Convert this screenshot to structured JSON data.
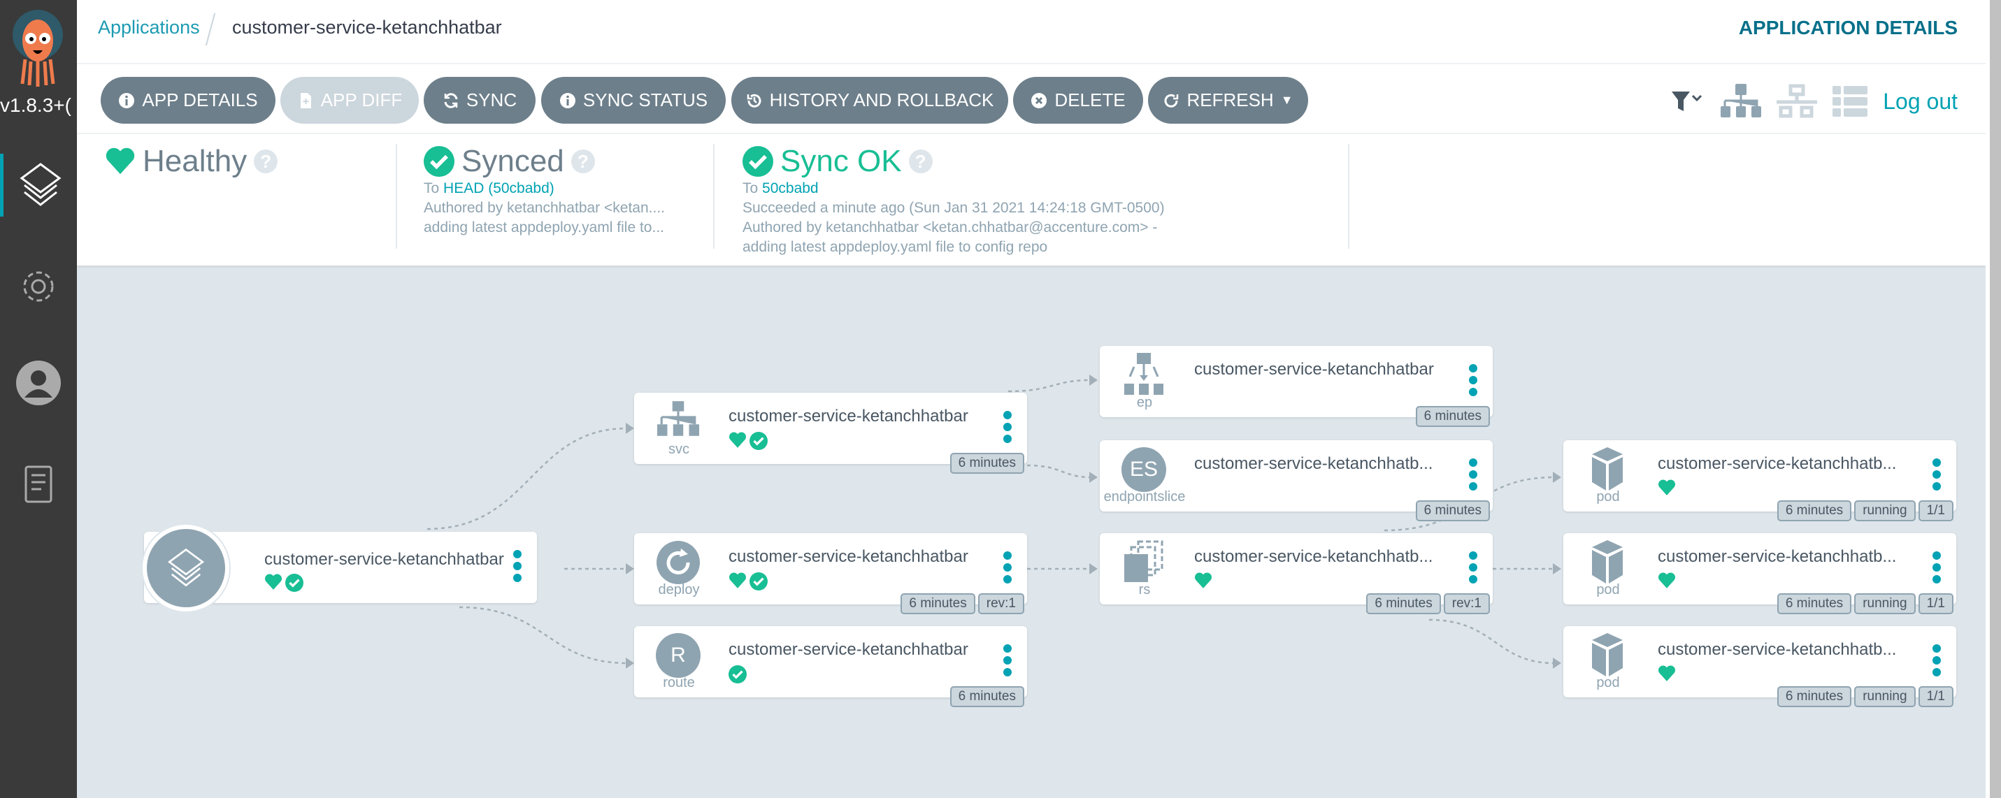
{
  "sidebar": {
    "version": "v1.8.3+(",
    "items": [
      {
        "name": "applications",
        "icon": "layers-icon",
        "active": true
      },
      {
        "name": "settings",
        "icon": "gear-icon",
        "active": false
      },
      {
        "name": "user-info",
        "icon": "user-icon",
        "active": false
      },
      {
        "name": "documentation",
        "icon": "docs-icon",
        "active": false
      }
    ]
  },
  "header": {
    "breadcrumb_root": "Applications",
    "breadcrumb_current": "customer-service-ketanchhatbar",
    "title": "APPLICATION DETAILS"
  },
  "toolbar": {
    "buttons": [
      {
        "label": "APP DETAILS",
        "icon": "info-icon",
        "disabled": false
      },
      {
        "label": "APP DIFF",
        "icon": "file-diff-icon",
        "disabled": true
      },
      {
        "label": "SYNC",
        "icon": "sync-icon",
        "disabled": false
      },
      {
        "label": "SYNC STATUS",
        "icon": "info-icon",
        "disabled": false
      },
      {
        "label": "HISTORY AND ROLLBACK",
        "icon": "history-icon",
        "disabled": false
      },
      {
        "label": "DELETE",
        "icon": "times-circle-icon",
        "disabled": false
      },
      {
        "label": "REFRESH",
        "icon": "redo-icon",
        "disabled": false
      }
    ],
    "logout": "Log out"
  },
  "status": {
    "health": {
      "label": "Healthy"
    },
    "sync": {
      "label": "Synced",
      "to_prefix": "To",
      "revision": "HEAD (50cbabd)",
      "author": "Authored by ketanchhatbar <ketan....",
      "message": "adding latest appdeploy.yaml file to..."
    },
    "operation": {
      "label": "Sync OK",
      "to_prefix": "To",
      "revision": "50cbabd",
      "time": "Succeeded a minute ago (Sun Jan 31 2021 14:24:18 GMT-0500)",
      "author": "Authored by ketanchhatbar <ketan.chhatbar@accenture.com> -",
      "message": "adding latest appdeploy.yaml file to config repo"
    }
  },
  "colors": {
    "accent": "#00a2b3",
    "healthy": "#18be94",
    "button": "#6d7f8b",
    "canvas": "#dee6eb"
  },
  "nodes": [
    {
      "kind": "",
      "title": "customer-service-ketanchhatbar",
      "health": true,
      "synced": true,
      "badges": [],
      "icon": "layers-icon"
    },
    {
      "kind": "svc",
      "title": "customer-service-ketanchhatbar",
      "health": true,
      "synced": true,
      "badges": [
        "6 minutes"
      ],
      "icon": "sitemap-icon"
    },
    {
      "kind": "deploy",
      "title": "customer-service-ketanchhatbar",
      "health": true,
      "synced": true,
      "badges": [
        "6 minutes",
        "rev:1"
      ],
      "icon": "deploy-icon"
    },
    {
      "kind": "route",
      "title": "customer-service-ketanchhatbar",
      "health": false,
      "synced": true,
      "badges": [
        "6 minutes"
      ],
      "icon": "route-icon",
      "icon_text": "R"
    },
    {
      "kind": "ep",
      "title": "customer-service-ketanchhatbar",
      "health": false,
      "synced": false,
      "badges": [
        "6 minutes"
      ],
      "icon": "endpoints-icon"
    },
    {
      "kind": "endpointslice",
      "title": "customer-service-ketanchhatb...",
      "health": false,
      "synced": false,
      "badges": [
        "6 minutes"
      ],
      "icon": "endpointslice-icon",
      "icon_text": "ES"
    },
    {
      "kind": "rs",
      "title": "customer-service-ketanchhatb...",
      "health": true,
      "synced": false,
      "badges": [
        "6 minutes",
        "rev:1"
      ],
      "icon": "replicaset-icon"
    },
    {
      "kind": "pod",
      "title": "customer-service-ketanchhatb...",
      "health": true,
      "synced": false,
      "badges": [
        "6 minutes",
        "running",
        "1/1"
      ],
      "icon": "cube-icon"
    },
    {
      "kind": "pod",
      "title": "customer-service-ketanchhatb...",
      "health": true,
      "synced": false,
      "badges": [
        "6 minutes",
        "running",
        "1/1"
      ],
      "icon": "cube-icon"
    },
    {
      "kind": "pod",
      "title": "customer-service-ketanchhatb...",
      "health": true,
      "synced": false,
      "badges": [
        "6 minutes",
        "running",
        "1/1"
      ],
      "icon": "cube-icon"
    }
  ]
}
